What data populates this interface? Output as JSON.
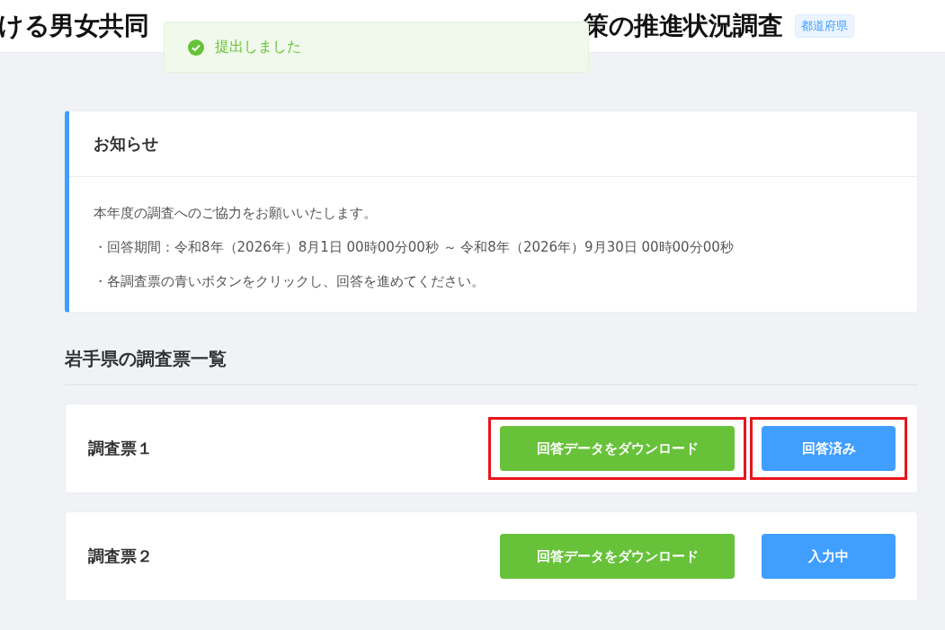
{
  "header": {
    "title_parts": [
      "ける男女共同",
      "策の推進状況調査"
    ],
    "badge": "都道府県"
  },
  "toast": {
    "message": "提出しました",
    "kind": "success"
  },
  "notice": {
    "title": "お知らせ",
    "lines": [
      "本年度の調査へのご協力をお願いいたします。",
      "・回答期間：令和8年（2026年）8月1日  00時00分00秒  ～  令和8年（2026年）9月30日  00時00分00秒",
      "・各調査票の青いボタンをクリックし、回答を進めてください。"
    ]
  },
  "section": {
    "title": "岩手県の調査票一覧"
  },
  "surveys": [
    {
      "name": "調査票１",
      "download": {
        "label": "回答データをダウンロード",
        "highlighted": true
      },
      "status": {
        "label": "回答済み",
        "highlighted": true
      }
    },
    {
      "name": "調査票２",
      "download": {
        "label": "回答データをダウンロード",
        "highlighted": false
      },
      "status": {
        "label": "入力中",
        "highlighted": false
      }
    }
  ]
}
